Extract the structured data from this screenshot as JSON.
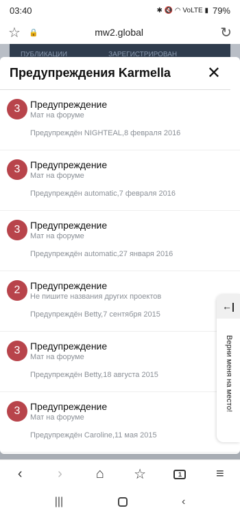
{
  "status_bar": {
    "time": "03:40",
    "icons": "✱ 🔇 ◠ VoLTE ▮",
    "battery": "79%"
  },
  "address_bar": {
    "url": "mw2.global"
  },
  "background_page": {
    "col1": "ПУБЛИКАЦИИ",
    "col2": "ЗАРЕГИСТРИРОВАН"
  },
  "modal": {
    "title": "Предупреждения Karmella",
    "close_icon": "✕",
    "warnings": [
      {
        "points": "3",
        "title": "Предупреждение",
        "reason": "Мат на форуме",
        "meta": "Предупреждён NIGHTEAL,8 февраля 2016"
      },
      {
        "points": "3",
        "title": "Предупреждение",
        "reason": "Мат на форуме",
        "meta": "Предупреждён automatic,7 февраля 2016"
      },
      {
        "points": "3",
        "title": "Предупреждение",
        "reason": "Мат на форуме",
        "meta": "Предупреждён automatic,27 января 2016"
      },
      {
        "points": "2",
        "title": "Предупреждение",
        "reason": "Не пишите названия других проектов",
        "meta": "Предупреждён Betty,7 сентября 2015"
      },
      {
        "points": "3",
        "title": "Предупреждение",
        "reason": "Мат на форуме",
        "meta": "Предупреждён Betty,18 августа 2015"
      },
      {
        "points": "3",
        "title": "Предупреждение",
        "reason": "Мат на форуме",
        "meta": "Предупреждён Caroline,11 мая 2015"
      }
    ]
  },
  "side_tab": {
    "text": "Верни меня на место!",
    "arrow": "←|"
  },
  "colors": {
    "badge": "#b8444b",
    "muted_text": "#8a8f96"
  },
  "browser_toolbar": {
    "tab_count": "1"
  }
}
